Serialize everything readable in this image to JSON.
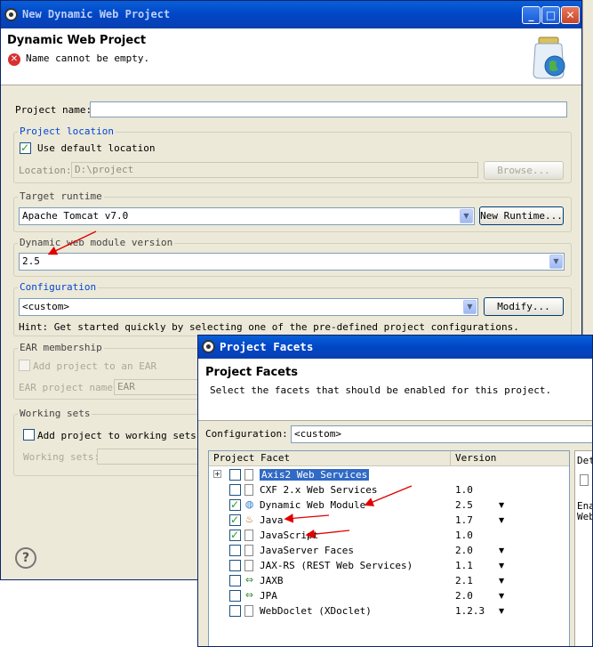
{
  "main": {
    "title": "New Dynamic Web Project",
    "header_title": "Dynamic Web Project",
    "error_message": "Name cannot be empty.",
    "project_name_label": "Project name:",
    "project_name_value": "",
    "project_location": {
      "title": "Project location",
      "use_default_label": "Use default location",
      "use_default_checked": true,
      "location_label": "Location:",
      "location_value": "D:\\project",
      "browse_label": "Browse..."
    },
    "target_runtime": {
      "title": "Target runtime",
      "value": "Apache Tomcat v7.0",
      "new_runtime_label": "New Runtime..."
    },
    "module_version": {
      "title": "Dynamic web module version",
      "value": "2.5"
    },
    "configuration": {
      "title": "Configuration",
      "value": "<custom>",
      "modify_label": "Modify...",
      "hint": "Hint: Get started quickly by selecting one of the pre-defined project configurations."
    },
    "ear": {
      "title": "EAR membership",
      "add_label": "Add project to an EAR",
      "name_label": "EAR project name:",
      "name_value": "EAR"
    },
    "working_sets": {
      "title": "Working sets",
      "add_label": "Add project to working sets",
      "sets_label": "Working sets:"
    }
  },
  "facets": {
    "title": "Project Facets",
    "header_title": "Project Facets",
    "description": "Select the facets that should be enabled for this project.",
    "configuration_label": "Configuration:",
    "configuration_value": "<custom>",
    "columns": [
      "Project Facet",
      "Version"
    ],
    "side_tab": "Det",
    "side_text_1": "Ena",
    "side_text_2": "Web",
    "rows": [
      {
        "name": "Axis2 Web Services",
        "version": "",
        "checked": false,
        "icon": "document-icon",
        "expandable": true,
        "selected": true,
        "dropdown": false
      },
      {
        "name": "CXF 2.x Web Services",
        "version": "1.0",
        "checked": false,
        "icon": "document-icon",
        "dropdown": false
      },
      {
        "name": "Dynamic Web Module",
        "version": "2.5",
        "checked": true,
        "icon": "web-module-icon",
        "dropdown": true
      },
      {
        "name": "Java",
        "version": "1.7",
        "checked": true,
        "icon": "java-icon",
        "dropdown": true
      },
      {
        "name": "JavaScript",
        "version": "1.0",
        "checked": true,
        "icon": "document-icon",
        "dropdown": false
      },
      {
        "name": "JavaServer Faces",
        "version": "2.0",
        "checked": false,
        "icon": "document-icon",
        "dropdown": true
      },
      {
        "name": "JAX-RS (REST Web Services)",
        "version": "1.1",
        "checked": false,
        "icon": "document-icon",
        "dropdown": true
      },
      {
        "name": "JAXB",
        "version": "2.1",
        "checked": false,
        "icon": "jaxb-icon",
        "dropdown": true
      },
      {
        "name": "JPA",
        "version": "2.0",
        "checked": false,
        "icon": "jpa-icon",
        "dropdown": true
      },
      {
        "name": "WebDoclet (XDoclet)",
        "version": "1.2.3",
        "checked": false,
        "icon": "document-icon",
        "dropdown": true
      }
    ]
  },
  "colors": {
    "accent": "#0046d5",
    "arrow": "#e00000",
    "title_bar": "#0a5fd8"
  }
}
